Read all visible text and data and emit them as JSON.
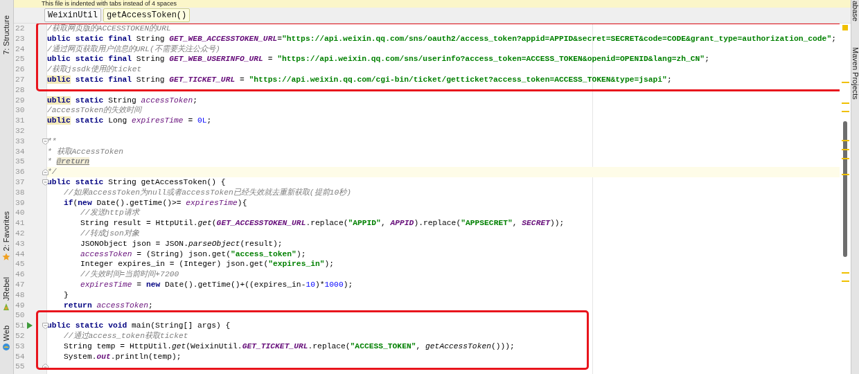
{
  "notice": {
    "text": "This file is indented with tabs instead of 4 spaces"
  },
  "breadcrumbs": [
    {
      "label": "WeixinUtil",
      "selected": false
    },
    {
      "label": "getAccessToken()",
      "selected": true
    }
  ],
  "left_tools": [
    {
      "label": "7: Structure",
      "kind": "plain"
    },
    {
      "label": "2: Favorites",
      "kind": "star"
    },
    {
      "label": "JRebel",
      "kind": "rebel"
    },
    {
      "label": "Web",
      "kind": "web"
    }
  ],
  "right_tools": [
    {
      "label": "abase"
    },
    {
      "label": "Maven Projects"
    }
  ],
  "blocks": [
    {
      "framed": true,
      "wide": true,
      "lines": [
        {
          "number": "22",
          "tokens": [
            {
              "kind": "comment",
              "text": "/获取网页版的ACCESSTOKEN的URL"
            }
          ]
        },
        {
          "number": "23",
          "tokens": [
            {
              "kind": "kw",
              "text": "ublic static final"
            },
            {
              "kind": "plain",
              "text": " String "
            },
            {
              "kind": "const",
              "text": "GET_WEB_ACCESSTOKEN_URL"
            },
            {
              "kind": "plain",
              "text": "="
            },
            {
              "kind": "str",
              "text": "\"https://api.weixin.qq.com/sns/oauth2/access_token?appid=APPID&secret=SECRET&code=CODE&grant_type=authorization_code\""
            },
            {
              "kind": "plain",
              "text": ";"
            }
          ]
        },
        {
          "number": "24",
          "tokens": [
            {
              "kind": "comment",
              "text": "/通过网页获取用户信息的URL(不需要关注公众号)"
            }
          ]
        },
        {
          "number": "25",
          "tokens": [
            {
              "kind": "kw",
              "text": "ublic static final"
            },
            {
              "kind": "plain",
              "text": " String "
            },
            {
              "kind": "const",
              "text": "GET_WEB_USERINFO_URL"
            },
            {
              "kind": "plain",
              "text": " = "
            },
            {
              "kind": "str",
              "text": "\"https://api.weixin.qq.com/sns/userinfo?access_token=ACCESS_TOKEN&openid=OPENID&lang=zh_CN\""
            },
            {
              "kind": "plain",
              "text": ";"
            }
          ]
        },
        {
          "number": "26",
          "tokens": [
            {
              "kind": "comment",
              "text": "/获取jssdk使用的ticket"
            }
          ]
        },
        {
          "number": "27",
          "tokens": [
            {
              "kind": "mark",
              "text": "ublic"
            },
            {
              "kind": "kw",
              "text": " static final"
            },
            {
              "kind": "plain",
              "text": " String "
            },
            {
              "kind": "const",
              "text": "GET_TICKET_URL"
            },
            {
              "kind": "plain",
              "text": " = "
            },
            {
              "kind": "str",
              "text": "\"https://api.weixin.qq.com/cgi-bin/ticket/getticket?access_token=ACCESS_TOKEN&type=jsapi\""
            },
            {
              "kind": "plain",
              "text": ";"
            }
          ]
        }
      ]
    },
    {
      "lines": [
        {
          "number": "28"
        },
        {
          "number": "29",
          "tokens": [
            {
              "kind": "mark",
              "text": "ublic"
            },
            {
              "kind": "kw",
              "text": " static"
            },
            {
              "kind": "plain",
              "text": " String "
            },
            {
              "kind": "field",
              "text": "accessToken"
            },
            {
              "kind": "plain",
              "text": ";"
            }
          ]
        },
        {
          "number": "30",
          "tokens": [
            {
              "kind": "comment",
              "text": "/accessToken的失效时间"
            }
          ]
        },
        {
          "number": "31",
          "tokens": [
            {
              "kind": "mark",
              "text": "ublic"
            },
            {
              "kind": "kw",
              "text": " static"
            },
            {
              "kind": "plain",
              "text": " Long "
            },
            {
              "kind": "field",
              "text": "expiresTime"
            },
            {
              "kind": "plain",
              "text": " = "
            },
            {
              "kind": "num",
              "text": "0L"
            },
            {
              "kind": "plain",
              "text": ";"
            }
          ]
        },
        {
          "number": "32"
        },
        {
          "number": "33",
          "fold_start": true,
          "tokens": [
            {
              "kind": "comment",
              "text": "**"
            }
          ]
        },
        {
          "number": "34",
          "tokens": [
            {
              "kind": "comment",
              "text": "* 获取AccessToken"
            }
          ]
        },
        {
          "number": "35",
          "tokens": [
            {
              "kind": "comment",
              "text": "* "
            },
            {
              "kind": "tag",
              "text": "@return"
            }
          ]
        },
        {
          "number": "36",
          "fold_end": true,
          "current": true,
          "tokens": [
            {
              "kind": "comment",
              "text": "*/"
            }
          ]
        },
        {
          "number": "37",
          "fold_start": true,
          "tokens": [
            {
              "kind": "kw",
              "text": "ublic static"
            },
            {
              "kind": "plain",
              "text": " String getAccessToken() {"
            }
          ]
        },
        {
          "number": "38",
          "tokens": [
            {
              "kind": "comment",
              "text": "\t//如果accessToken为null或者accessToken已经失效就去重新获取(提前10秒)"
            }
          ]
        },
        {
          "number": "39",
          "tokens": [
            {
              "kind": "kw",
              "text": "\tif"
            },
            {
              "kind": "plain",
              "text": "("
            },
            {
              "kind": "kw",
              "text": "new"
            },
            {
              "kind": "plain",
              "text": " Date().getTime()>= "
            },
            {
              "kind": "field",
              "text": "expiresTime"
            },
            {
              "kind": "plain",
              "text": "){"
            }
          ]
        },
        {
          "number": "40",
          "tokens": [
            {
              "kind": "comment",
              "text": "\t\t//发送http请求"
            }
          ]
        },
        {
          "number": "41",
          "tokens": [
            {
              "kind": "plain",
              "text": "\t\tString result = HttpUtil."
            },
            {
              "kind": "method",
              "text": "get"
            },
            {
              "kind": "plain",
              "text": "("
            },
            {
              "kind": "const",
              "text": "GET_ACCESSTOKEN_URL"
            },
            {
              "kind": "plain",
              "text": ".replace("
            },
            {
              "kind": "str",
              "text": "\"APPID\""
            },
            {
              "kind": "plain",
              "text": ", "
            },
            {
              "kind": "const",
              "text": "APPID"
            },
            {
              "kind": "plain",
              "text": ").replace("
            },
            {
              "kind": "str",
              "text": "\"APPSECRET\""
            },
            {
              "kind": "plain",
              "text": ", "
            },
            {
              "kind": "const",
              "text": "SECRET"
            },
            {
              "kind": "plain",
              "text": "));"
            }
          ]
        },
        {
          "number": "42",
          "tokens": [
            {
              "kind": "comment",
              "text": "\t\t//转成json对象"
            }
          ]
        },
        {
          "number": "43",
          "tokens": [
            {
              "kind": "plain",
              "text": "\t\tJSONObject json = JSON."
            },
            {
              "kind": "method",
              "text": "parseObject"
            },
            {
              "kind": "plain",
              "text": "(result);"
            }
          ]
        },
        {
          "number": "44",
          "tokens": [
            {
              "kind": "field",
              "text": "\t\taccessToken"
            },
            {
              "kind": "plain",
              "text": " = (String) json.get("
            },
            {
              "kind": "str",
              "text": "\"access_token\""
            },
            {
              "kind": "plain",
              "text": ");"
            }
          ]
        },
        {
          "number": "45",
          "tokens": [
            {
              "kind": "plain",
              "text": "\t\tInteger expires_in = (Integer) json.get("
            },
            {
              "kind": "str",
              "text": "\"expires_in\""
            },
            {
              "kind": "plain",
              "text": ");"
            }
          ]
        },
        {
          "number": "46",
          "tokens": [
            {
              "kind": "comment",
              "text": "\t\t//失效时间=当前时间+7200"
            }
          ]
        },
        {
          "number": "47",
          "tokens": [
            {
              "kind": "field",
              "text": "\t\texpiresTime"
            },
            {
              "kind": "plain",
              "text": " = "
            },
            {
              "kind": "kw",
              "text": "new"
            },
            {
              "kind": "plain",
              "text": " Date().getTime()+((expires_in-"
            },
            {
              "kind": "num",
              "text": "10"
            },
            {
              "kind": "plain",
              "text": ")*"
            },
            {
              "kind": "num",
              "text": "1000"
            },
            {
              "kind": "plain",
              "text": ");"
            }
          ]
        },
        {
          "number": "48",
          "tokens": [
            {
              "kind": "plain",
              "text": "\t}"
            }
          ]
        },
        {
          "number": "49",
          "tokens": [
            {
              "kind": "kw",
              "text": "\treturn"
            },
            {
              "kind": "field",
              "text": " accessToken"
            },
            {
              "kind": "plain",
              "text": ";"
            }
          ]
        }
      ]
    },
    {
      "framed": true,
      "wide": false,
      "lines": [
        {
          "number": "50"
        },
        {
          "number": "51",
          "fold_start": true,
          "run": true,
          "tokens": [
            {
              "kind": "kw",
              "text": "ublic static void"
            },
            {
              "kind": "plain",
              "text": " main(String[] args) {"
            }
          ]
        },
        {
          "number": "52",
          "tokens": [
            {
              "kind": "comment",
              "text": "\t//通过access_token获取ticket"
            }
          ]
        },
        {
          "number": "53",
          "tokens": [
            {
              "kind": "plain",
              "text": "\tString temp = HttpUtil."
            },
            {
              "kind": "method",
              "text": "get"
            },
            {
              "kind": "plain",
              "text": "(WeixinUtil."
            },
            {
              "kind": "const",
              "text": "GET_TICKET_URL"
            },
            {
              "kind": "plain",
              "text": ".replace("
            },
            {
              "kind": "str",
              "text": "\"ACCESS_TOKEN\""
            },
            {
              "kind": "plain",
              "text": ", "
            },
            {
              "kind": "method",
              "text": "getAccessToken"
            },
            {
              "kind": "plain",
              "text": "()));"
            }
          ]
        },
        {
          "number": "54",
          "tokens": [
            {
              "kind": "plain",
              "text": "\tSystem."
            },
            {
              "kind": "sfield",
              "text": "out"
            },
            {
              "kind": "plain",
              "text": ".println(temp);"
            }
          ]
        },
        {
          "number": "55",
          "fold_end": true
        }
      ]
    }
  ]
}
